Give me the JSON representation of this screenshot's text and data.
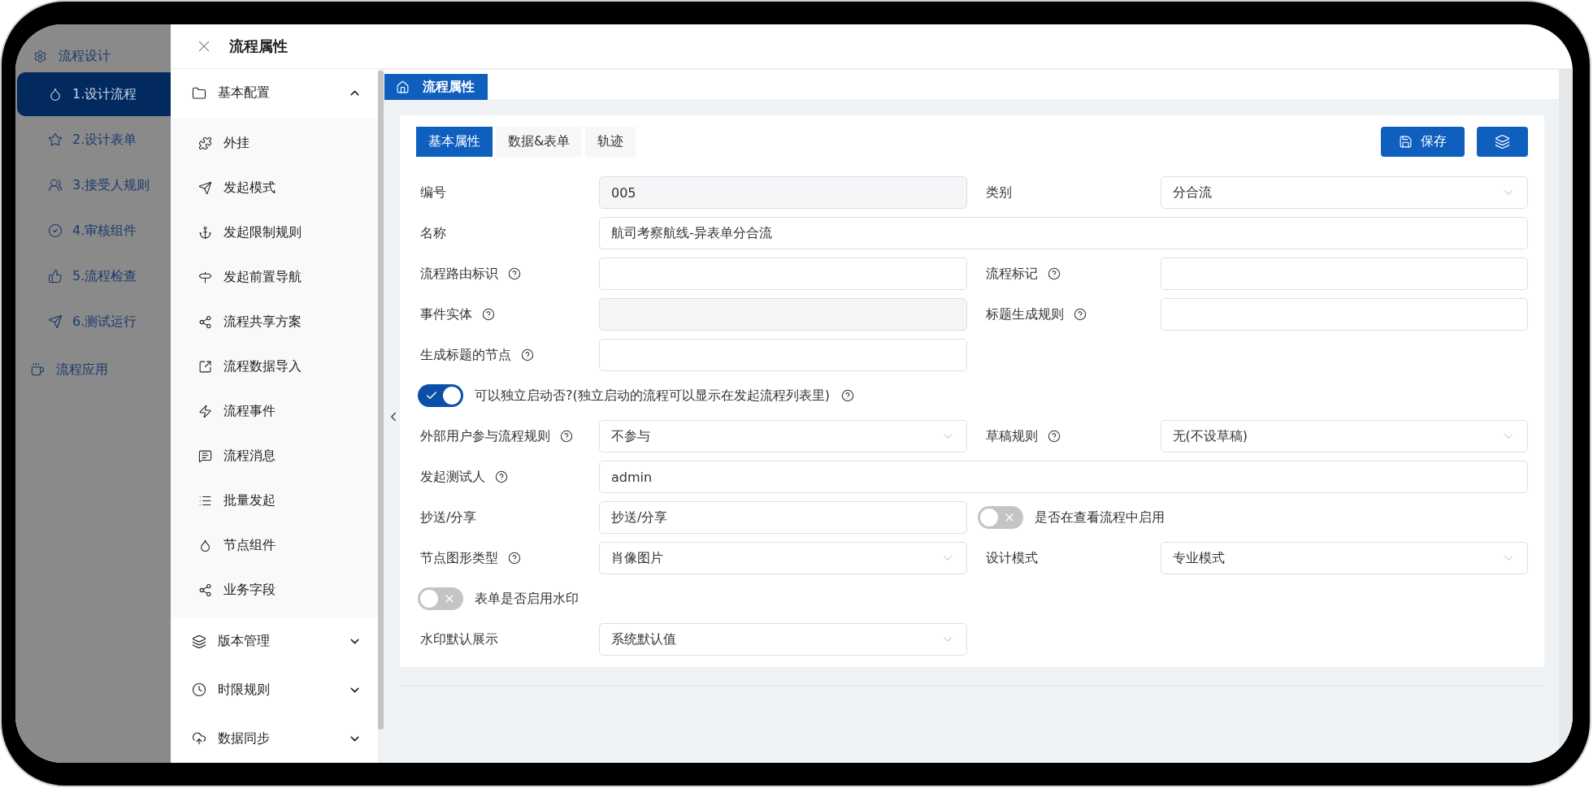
{
  "nav": {
    "title": "流程设计",
    "items": [
      {
        "label": "1.设计流程",
        "selected": true
      },
      {
        "label": "2.设计表单",
        "selected": false
      },
      {
        "label": "3.接受人规则",
        "selected": false
      },
      {
        "label": "4.审核组件",
        "selected": false
      },
      {
        "label": "5.流程检查",
        "selected": false
      },
      {
        "label": "6.测试运行",
        "selected": false
      }
    ],
    "footer": "流程应用"
  },
  "drawer": {
    "title": "流程属性",
    "sections": [
      {
        "label": "基本配置",
        "expanded": true,
        "children": [
          "外挂",
          "发起模式",
          "发起限制规则",
          "发起前置导航",
          "流程共享方案",
          "流程数据导入",
          "流程事件",
          "流程消息",
          "批量发起",
          "节点组件",
          "业务字段"
        ]
      },
      {
        "label": "版本管理",
        "expanded": false
      },
      {
        "label": "时限规则",
        "expanded": false
      },
      {
        "label": "数据同步",
        "expanded": false
      }
    ]
  },
  "breadcrumb": "流程属性",
  "tabs": [
    {
      "label": "基本属性",
      "selected": true
    },
    {
      "label": "数据&表单",
      "selected": false
    },
    {
      "label": "轨迹",
      "selected": false
    }
  ],
  "save_button": "保存",
  "form": {
    "rows": [
      {
        "kind": "pair",
        "items": [
          {
            "kind": "readonly",
            "label": "编号",
            "help": false,
            "value": "005"
          },
          {
            "kind": "select",
            "label": "类别",
            "help": false,
            "value": "分合流"
          }
        ]
      },
      {
        "kind": "wide",
        "items": [
          {
            "kind": "input",
            "label": "名称",
            "help": false,
            "value": "航司考察航线-异表单分合流"
          }
        ]
      },
      {
        "kind": "pair",
        "items": [
          {
            "kind": "input",
            "label": "流程路由标识",
            "help": true
          },
          {
            "kind": "input",
            "label": "流程标记",
            "help": true
          }
        ]
      },
      {
        "kind": "pair",
        "items": [
          {
            "kind": "readonly",
            "label": "事件实体",
            "help": true
          },
          {
            "kind": "input",
            "label": "标题生成规则",
            "help": true
          }
        ]
      },
      {
        "kind": "half",
        "items": [
          {
            "kind": "input",
            "label": "生成标题的节点",
            "help": true
          }
        ]
      },
      {
        "kind": "wide",
        "items": [
          {
            "kind": "toggle",
            "label": "可以独立启动否?(独立启动的流程可以显示在发起流程列表里)",
            "help": true,
            "on": true
          }
        ]
      },
      {
        "kind": "pair",
        "items": [
          {
            "kind": "select",
            "label": "外部用户参与流程规则",
            "help": true,
            "value": "不参与"
          },
          {
            "kind": "select",
            "label": "草稿规则",
            "help": true,
            "value": "无(不设草稿)"
          }
        ]
      },
      {
        "kind": "wide",
        "items": [
          {
            "kind": "input",
            "label": "发起测试人",
            "help": true,
            "value": "admin"
          }
        ]
      },
      {
        "kind": "pair",
        "items": [
          {
            "kind": "input",
            "label": "抄送/分享",
            "help": false,
            "value": "抄送/分享"
          },
          {
            "kind": "toggle",
            "label": "是否在查看流程中启用",
            "help": false,
            "on": false
          }
        ]
      },
      {
        "kind": "pair",
        "items": [
          {
            "kind": "select",
            "label": "节点图形类型",
            "help": true,
            "value": "肖像图片"
          },
          {
            "kind": "select",
            "label": "设计模式",
            "help": false,
            "value": "专业模式"
          }
        ]
      },
      {
        "kind": "wide",
        "items": [
          {
            "kind": "toggle",
            "label": "表单是否启用水印",
            "help": false,
            "on": false
          }
        ]
      },
      {
        "kind": "half",
        "items": [
          {
            "kind": "select",
            "label": "水印默认展示",
            "help": false,
            "value": "系统默认值"
          }
        ]
      }
    ]
  }
}
